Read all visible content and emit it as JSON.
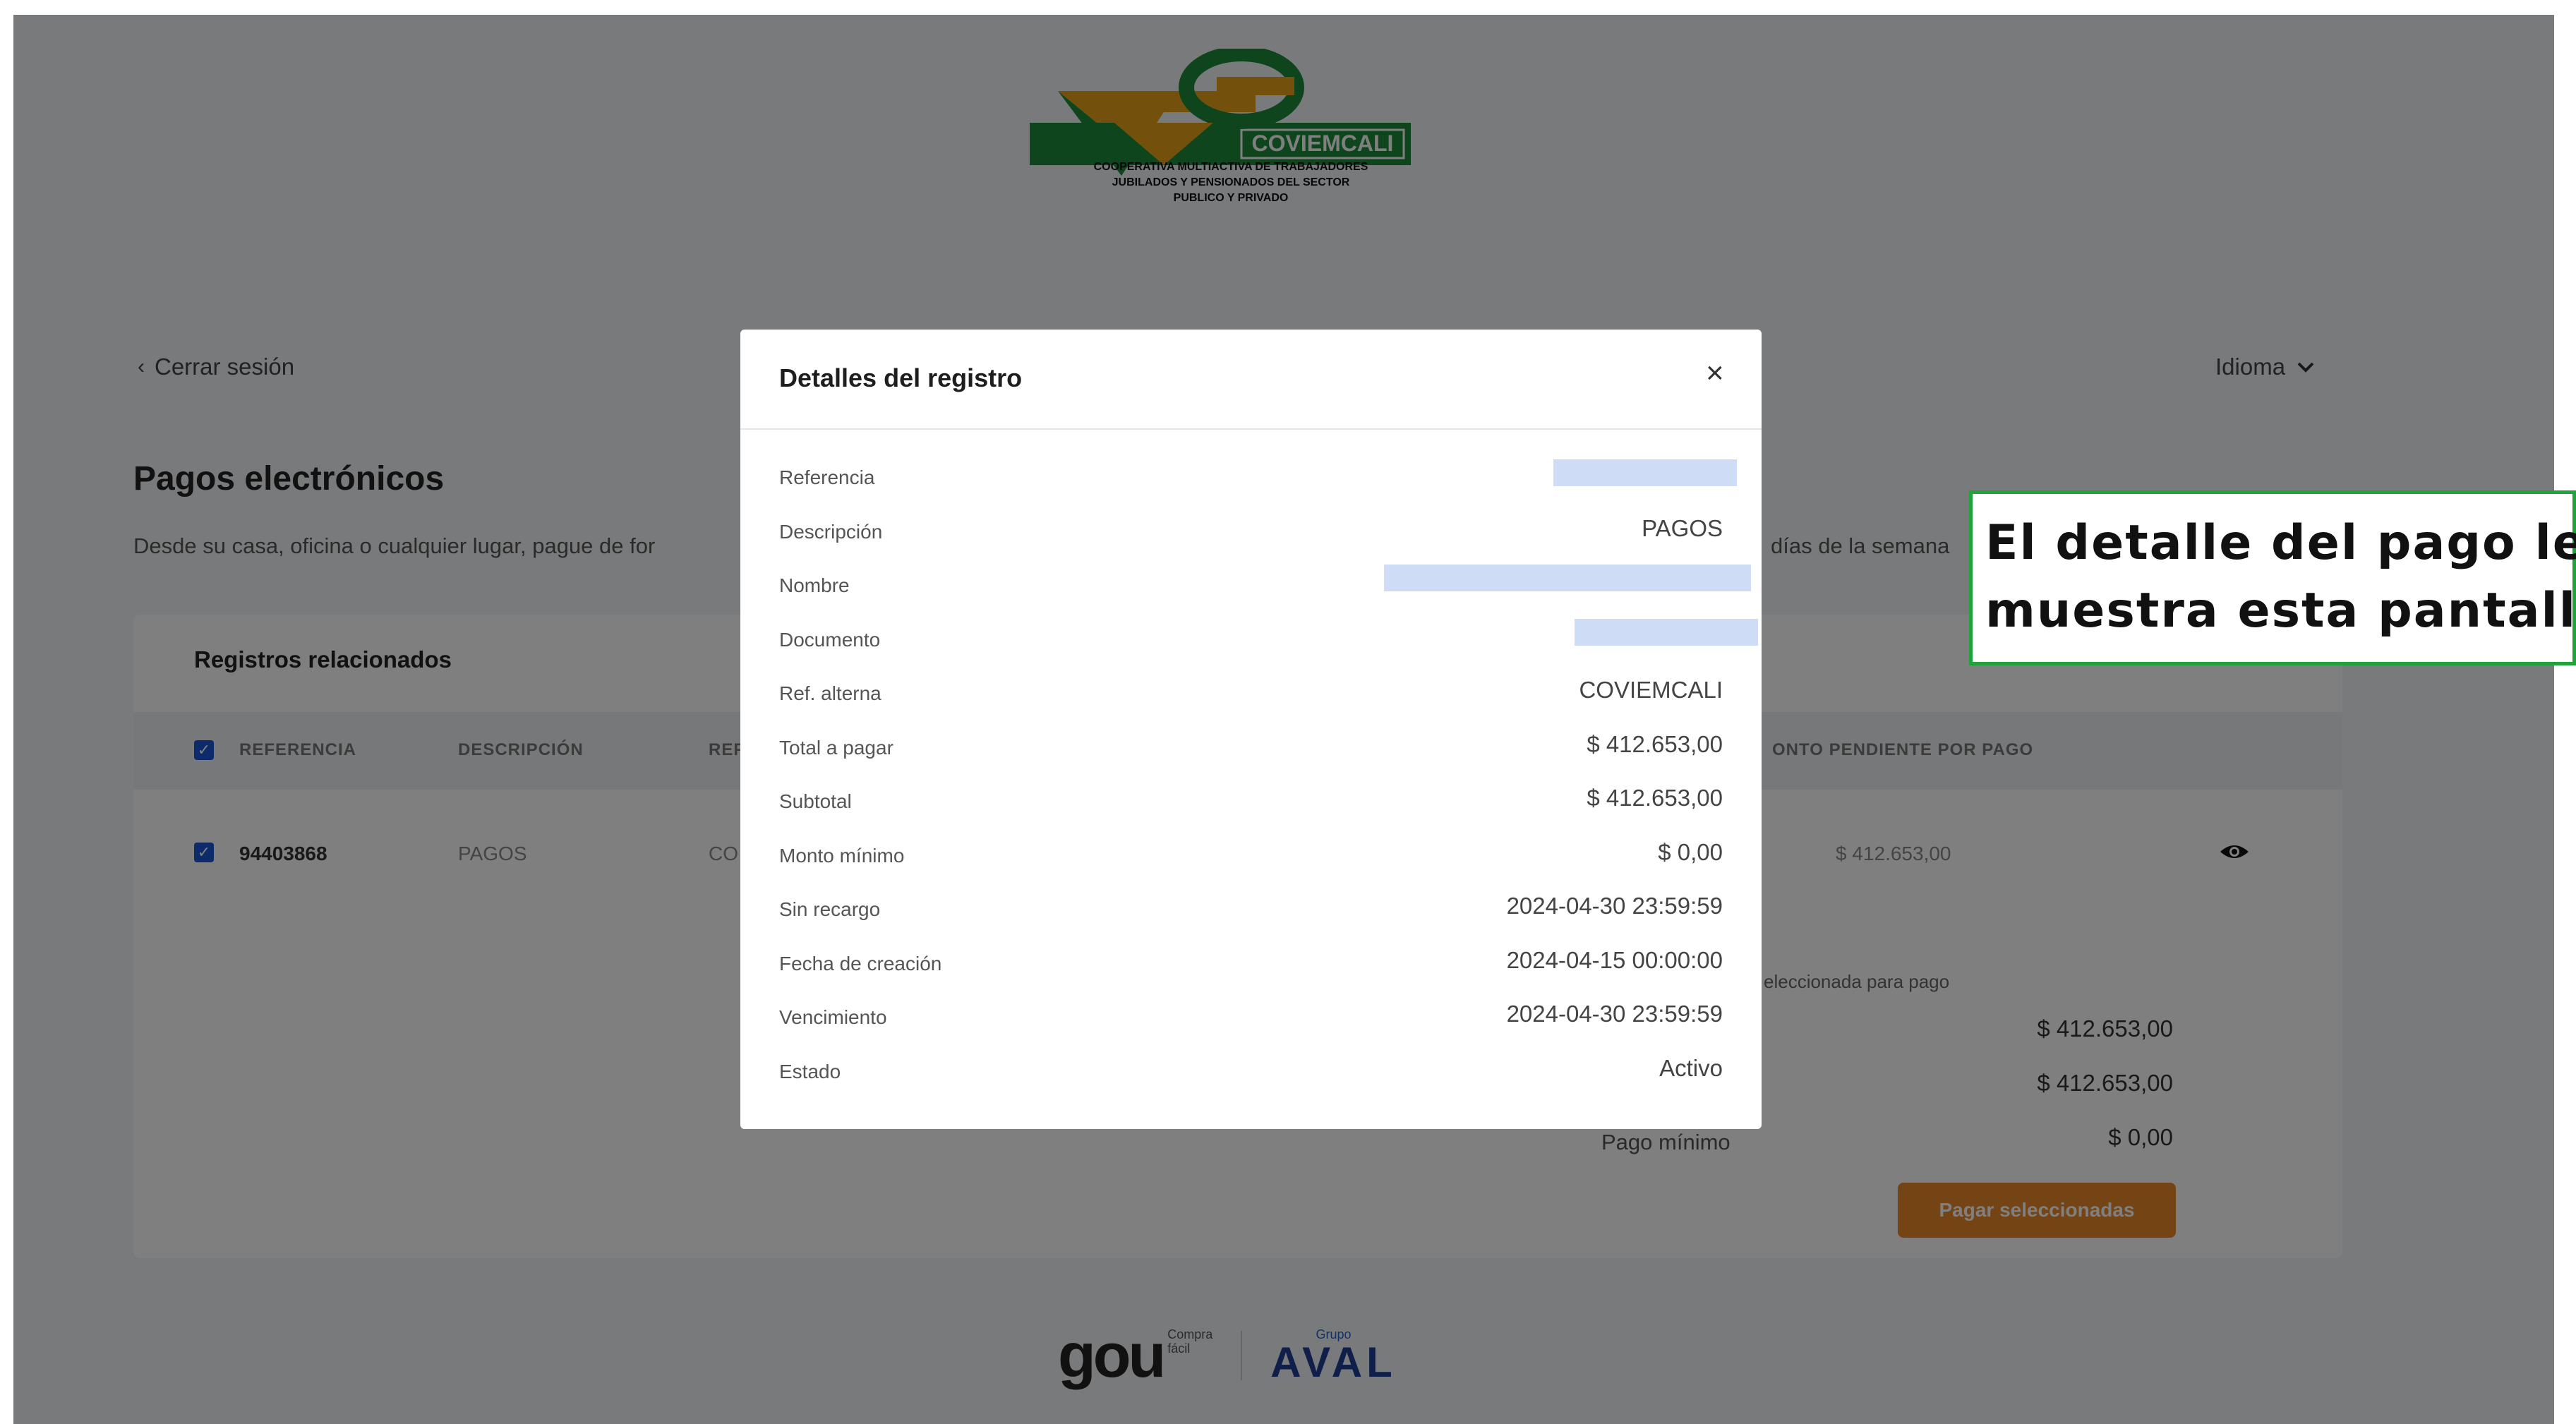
{
  "header": {
    "logo_name": "COVIEMCALI",
    "tagline_lines": [
      "COOPERATIVA MULTIACTIVA DE TRABAJADORES",
      "JUBILADOS Y PENSIONADOS DEL SECTOR",
      "PUBLICO Y PRIVADO"
    ],
    "logout_label": "Cerrar sesión",
    "language_label": "Idioma"
  },
  "main": {
    "title": "Pagos electrónicos",
    "description_start": "Desde su casa, oficina o cualquier lugar, pague de for",
    "description_end": "días de la semana"
  },
  "records": {
    "title": "Registros relacionados",
    "columns": {
      "referencia": "REFERENCIA",
      "descripcion": "DESCRIPCIÓN",
      "ref_partial": "REF",
      "monto_partial": "ONTO PENDIENTE POR PAGO"
    },
    "row": {
      "referencia": "94403868",
      "descripcion": "PAGOS",
      "ref_partial": "CO",
      "monto": "$ 412.653,00"
    },
    "selected_label": "eleccionada para pago",
    "totals": [
      "$ 412.653,00",
      "$ 412.653,00",
      "$ 0,00"
    ],
    "min_label_partial": "Pago mínimo",
    "pay_button": "Pagar seleccionadas"
  },
  "modal": {
    "title": "Detalles del registro",
    "close_symbol": "×",
    "rows": [
      {
        "label": "Referencia",
        "value": ""
      },
      {
        "label": "Descripción",
        "value": "PAGOS"
      },
      {
        "label": "Nombre",
        "value": ""
      },
      {
        "label": "Documento",
        "value": ""
      },
      {
        "label": "Ref. alterna",
        "value": "COVIEMCALI"
      },
      {
        "label": "Total a pagar",
        "value": "$ 412.653,00"
      },
      {
        "label": "Subtotal",
        "value": "$ 412.653,00"
      },
      {
        "label": "Monto mínimo",
        "value": "$ 0,00"
      },
      {
        "label": "Sin recargo",
        "value": "2024-04-30 23:59:59"
      },
      {
        "label": "Fecha de creación",
        "value": "2024-04-15 00:00:00"
      },
      {
        "label": "Vencimiento",
        "value": "2024-04-30 23:59:59"
      },
      {
        "label": "Estado",
        "value": "Activo"
      }
    ]
  },
  "footer": {
    "gou": "gou",
    "gou_sub_1": "Compra",
    "gou_sub_2": "fácil",
    "aval_small": "Grupo",
    "aval": "AVAL"
  },
  "annotation": {
    "line1": "El detalle del pago le",
    "line2": "muestra esta pantalla"
  },
  "colors": {
    "accent_blue": "#1b57d6",
    "pay_button": "#e8892a",
    "logo_green": "#1f8a3a",
    "logo_orange": "#e6a21a",
    "annotation_border": "#1fa33a"
  }
}
